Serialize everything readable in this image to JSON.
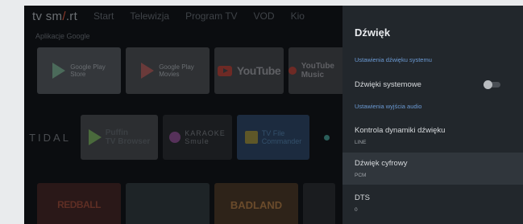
{
  "home": {
    "logo_prefix": "tv sm",
    "logo_slash": "/",
    "logo_suffix": ".rt",
    "nav": [
      "Start",
      "Telewizja",
      "Program TV",
      "VOD",
      "Kio"
    ],
    "section_title": "Aplikacje Google",
    "apps_row1": [
      {
        "line1": "Google Play",
        "line2": "Store"
      },
      {
        "line1": "Google Play",
        "line2": "Movies"
      },
      {
        "label": "YouTube"
      },
      {
        "label": "YouTube Music"
      }
    ],
    "apps_row2": {
      "tidal": "TIDAL",
      "puffin_line1": "Puffin",
      "puffin_line2": "TV Browser",
      "karaoke_line1": "KARAOKE",
      "karaoke_line2": "Smule",
      "tvfile_line1": "TV File",
      "tvfile_line2": "Commander"
    },
    "games": [
      "REDBALL",
      "",
      "BADLAND"
    ]
  },
  "panel": {
    "title": "Dźwięk",
    "section_system": "Ustawienia dźwięku systemu",
    "system_sounds": {
      "label": "Dźwięki systemowe",
      "toggle_on": false
    },
    "section_output": "Ustawienia wyjścia audio",
    "items": [
      {
        "label": "Kontrola dynamiki dźwięku",
        "value": "LINE",
        "selected": false
      },
      {
        "label": "Dźwięk cyfrowy",
        "value": "PCM",
        "selected": true
      },
      {
        "label": "DTS",
        "value": "0",
        "selected": false
      }
    ]
  }
}
